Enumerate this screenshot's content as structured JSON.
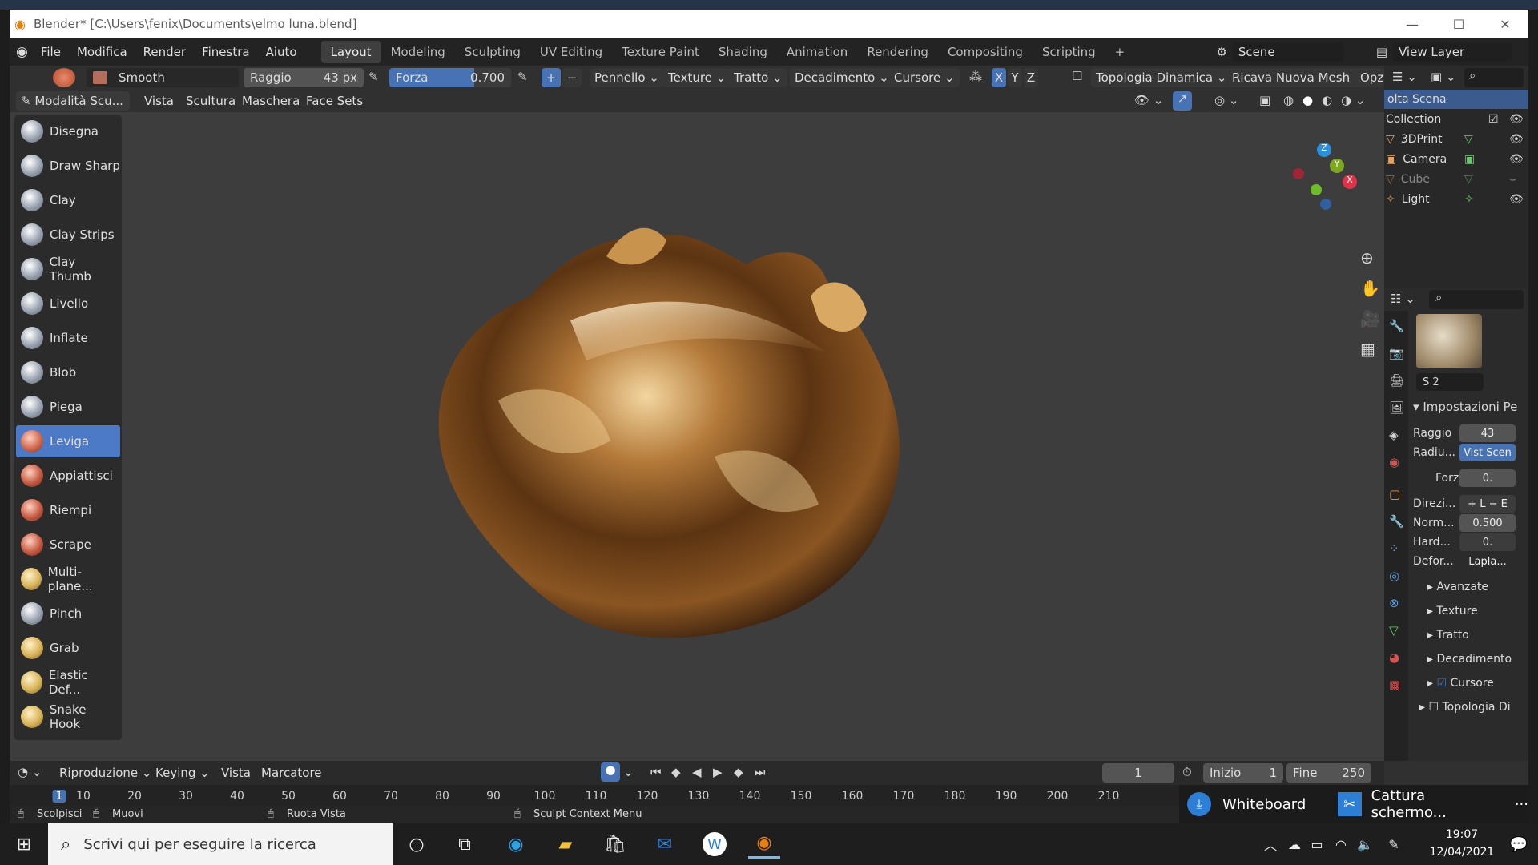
{
  "window": {
    "title": "Blender* [C:\\Users\\fenix\\Documents\\elmo luna.blend]",
    "minimize": "—",
    "maximize": "☐",
    "close": "✕"
  },
  "menus": [
    "File",
    "Modifica",
    "Render",
    "Finestra",
    "Aiuto"
  ],
  "workspaces": [
    "Layout",
    "Modeling",
    "Sculpting",
    "UV Editing",
    "Texture Paint",
    "Shading",
    "Animation",
    "Rendering",
    "Compositing",
    "Scripting"
  ],
  "scene": {
    "label": "Scene",
    "view_layer": "View Layer"
  },
  "tool_header": {
    "brush": "Smooth",
    "radius_label": "Raggio",
    "radius_value": "43 px",
    "strength_label": "Forza",
    "strength_value": "0.700",
    "strength_fraction": 0.7,
    "pennello": "Pennello",
    "texture": "Texture",
    "tratto": "Tratto",
    "decadimento": "Decadimento",
    "cursore": "Cursore",
    "axes": [
      "X",
      "Y",
      "Z"
    ],
    "dyntopo": "Topologia Dinamica",
    "remesh": "Ricava Nuova Mesh",
    "options": "Opzio"
  },
  "header2": {
    "mode": "Modalità Scu...",
    "items": [
      "Vista",
      "Scultura",
      "Maschera",
      "Face Sets"
    ]
  },
  "tools": [
    "Disegna",
    "Draw Sharp",
    "Clay",
    "Clay Strips",
    "Clay Thumb",
    "Livello",
    "Inflate",
    "Blob",
    "Piega",
    "Leviga",
    "Appiattisci",
    "Riempi",
    "Scrape",
    "Multi-plane...",
    "Pinch",
    "Grab",
    "Elastic Def...",
    "Snake Hook"
  ],
  "active_tool": "Leviga",
  "gizmo": {
    "x": "X",
    "y": "Y",
    "z": "Z"
  },
  "outliner": {
    "scene_collection": "olta Scena",
    "collection": "Collection",
    "items": [
      "3DPrint",
      "Camera",
      "Cube",
      "Light"
    ]
  },
  "properties": {
    "section": "Impostazioni Pe",
    "rows": [
      {
        "label": "Raggio",
        "value": "43"
      },
      {
        "label": "Radiu...",
        "value": "Vist Scen"
      },
      {
        "label": "Forza",
        "value": "0."
      },
      {
        "label": "Direzi...",
        "value": "+ L  − E"
      },
      {
        "label": "Norm...",
        "value": "0.500"
      },
      {
        "label": "Hard...",
        "value": "0."
      },
      {
        "label": "Defor...",
        "value": "Lapla..."
      }
    ],
    "subpanels": [
      "Avanzate",
      "Texture",
      "Tratto",
      "Decadimento",
      "Cursore",
      "Topologia Di"
    ],
    "brush_slot": "S  2"
  },
  "timeline": {
    "menus": [
      "Riproduzione",
      "Keying",
      "Vista",
      "Marcatore"
    ],
    "current_frame": "1",
    "start_label": "Inizio",
    "start": "1",
    "end_label": "Fine",
    "end": "250",
    "ticks": [
      "1",
      "10",
      "20",
      "30",
      "40",
      "50",
      "60",
      "70",
      "80",
      "90",
      "100",
      "110",
      "120",
      "130",
      "140",
      "150",
      "160",
      "170",
      "180",
      "190",
      "200",
      "210"
    ]
  },
  "statusbar": {
    "sculpt": "Scolpisci",
    "move": "Muovi",
    "rotate": "Ruota Vista",
    "context": "Sculpt Context Menu"
  },
  "notifications": {
    "whiteboard": "Whiteboard",
    "capture": "Cattura schermo...",
    "more": "···"
  },
  "taskbar": {
    "search_placeholder": "Scrivi qui per eseguire la ricerca",
    "time": "19:07",
    "date": "12/04/2021"
  }
}
